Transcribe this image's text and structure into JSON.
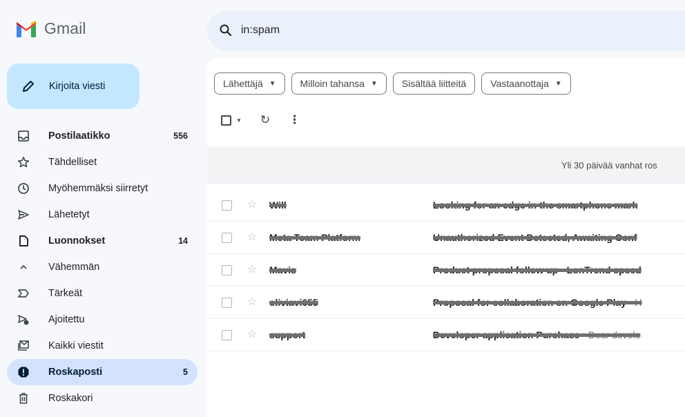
{
  "app": {
    "name": "Gmail"
  },
  "search": {
    "query": "in:spam"
  },
  "compose": {
    "label": "Kirjoita viesti"
  },
  "sidebar": {
    "items": [
      {
        "label": "Postilaatikko",
        "count": "556",
        "icon": "inbox-icon"
      },
      {
        "label": "Tähdelliset",
        "count": "",
        "icon": "star-icon"
      },
      {
        "label": "Myöhemmäksi siirretyt",
        "count": "",
        "icon": "clock-icon"
      },
      {
        "label": "Lähetetyt",
        "count": "",
        "icon": "send-icon"
      },
      {
        "label": "Luonnokset",
        "count": "14",
        "icon": "draft-icon"
      },
      {
        "label": "Vähemmän",
        "count": "",
        "icon": "chevron-up-icon"
      },
      {
        "label": "Tärkeät",
        "count": "",
        "icon": "important-icon"
      },
      {
        "label": "Ajoitettu",
        "count": "",
        "icon": "scheduled-icon"
      },
      {
        "label": "Kaikki viestit",
        "count": "",
        "icon": "all-mail-icon"
      },
      {
        "label": "Roskaposti",
        "count": "5",
        "icon": "spam-icon"
      },
      {
        "label": "Roskakori",
        "count": "",
        "icon": "trash-icon"
      }
    ]
  },
  "filters": {
    "chips": [
      {
        "label": "Lähettäjä",
        "dropdown": true
      },
      {
        "label": "Milloin tahansa",
        "dropdown": true
      },
      {
        "label": "Sisältää liitteitä",
        "dropdown": false
      },
      {
        "label": "Vastaanottaja",
        "dropdown": true
      }
    ]
  },
  "banner": {
    "text": "Yli 30 päivää vanhat ros"
  },
  "emails": [
    {
      "sender": "Will",
      "subject": "Looking for an edge in the smartphone mark",
      "snippet": ""
    },
    {
      "sender": "Meta Team Platform",
      "subject": "Unauthorized Event Detected, Awaiting Conf",
      "snippet": ""
    },
    {
      "sender": "Mavis",
      "subject": "Product proposal follow up - LonTrend speed",
      "snippet": ""
    },
    {
      "sender": "oliviavi655",
      "subject": "Proposal for collaboration on Google Play",
      "snippet": " - H"
    },
    {
      "sender": "support",
      "subject": "Developer application Purchase",
      "snippet": " - Dear develo"
    }
  ],
  "colors": {
    "accent": "#c2e7ff",
    "active_nav": "#d3e3fd",
    "search_bg": "#eaf1fb",
    "page_bg": "#f6f8fc"
  }
}
